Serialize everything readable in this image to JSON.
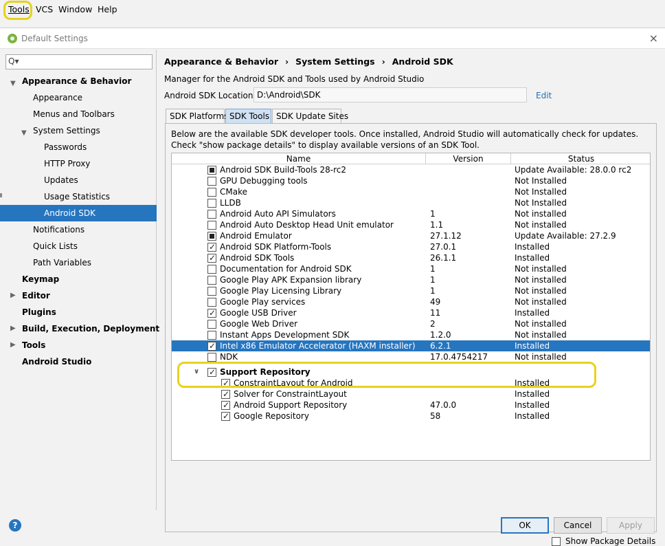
{
  "menubar": {
    "items": [
      "Tools",
      "VCS",
      "Window",
      "Help"
    ]
  },
  "dialog": {
    "title": "Default Settings",
    "close": "×"
  },
  "sidebar": {
    "search_placeholder": "Q▾",
    "items": [
      {
        "label": "Appearance & Behavior"
      },
      {
        "label": "Appearance"
      },
      {
        "label": "Menus and Toolbars"
      },
      {
        "label": "System Settings"
      },
      {
        "label": "Passwords"
      },
      {
        "label": "HTTP Proxy"
      },
      {
        "label": "Updates"
      },
      {
        "label": "Usage Statistics"
      },
      {
        "label": "Android SDK"
      },
      {
        "label": "Notifications"
      },
      {
        "label": "Quick Lists"
      },
      {
        "label": "Path Variables"
      },
      {
        "label": "Keymap"
      },
      {
        "label": "Editor"
      },
      {
        "label": "Plugins"
      },
      {
        "label": "Build, Execution, Deployment"
      },
      {
        "label": "Tools"
      },
      {
        "label": "Android Studio"
      }
    ]
  },
  "main": {
    "breadcrumb": [
      "Appearance & Behavior",
      "System Settings",
      "Android SDK"
    ],
    "breadcrumb_sep": "›",
    "description": "Manager for the Android SDK and Tools used by Android Studio",
    "sdk_location_label": "Android SDK Location:",
    "sdk_location_value": "D:\\Android\\SDK",
    "edit_label": "Edit",
    "tabs": [
      {
        "label": "SDK Platforms"
      },
      {
        "label": "SDK Tools"
      },
      {
        "label": "SDK Update Sites"
      }
    ],
    "info_line1": "Below are the available SDK developer tools. Once installed, Android Studio will automatically check for updates.",
    "info_line2": "Check \"show package details\" to display available versions of an SDK Tool.",
    "columns": [
      "Name",
      "Version",
      "Status"
    ],
    "rows": [
      {
        "name": "Android SDK Build-Tools 28-rc2",
        "version": "",
        "status": "Update Available: 28.0.0 rc2",
        "check": "partial"
      },
      {
        "name": "GPU Debugging tools",
        "version": "",
        "status": "Not Installed",
        "check": "none"
      },
      {
        "name": "CMake",
        "version": "",
        "status": "Not Installed",
        "check": "none"
      },
      {
        "name": "LLDB",
        "version": "",
        "status": "Not Installed",
        "check": "none"
      },
      {
        "name": "Android Auto API Simulators",
        "version": "1",
        "status": "Not installed",
        "check": "none"
      },
      {
        "name": "Android Auto Desktop Head Unit emulator",
        "version": "1.1",
        "status": "Not installed",
        "check": "none"
      },
      {
        "name": "Android Emulator",
        "version": "27.1.12",
        "status": "Update Available: 27.2.9",
        "check": "partial"
      },
      {
        "name": "Android SDK Platform-Tools",
        "version": "27.0.1",
        "status": "Installed",
        "check": "checked"
      },
      {
        "name": "Android SDK Tools",
        "version": "26.1.1",
        "status": "Installed",
        "check": "checked"
      },
      {
        "name": "Documentation for Android SDK",
        "version": "1",
        "status": "Not installed",
        "check": "none"
      },
      {
        "name": "Google Play APK Expansion library",
        "version": "1",
        "status": "Not installed",
        "check": "none"
      },
      {
        "name": "Google Play Licensing Library",
        "version": "1",
        "status": "Not installed",
        "check": "none"
      },
      {
        "name": "Google Play services",
        "version": "49",
        "status": "Not installed",
        "check": "none"
      },
      {
        "name": "Google USB Driver",
        "version": "11",
        "status": "Installed",
        "check": "checked"
      },
      {
        "name": "Google Web Driver",
        "version": "2",
        "status": "Not installed",
        "check": "none"
      },
      {
        "name": "Instant Apps Development SDK",
        "version": "1.2.0",
        "status": "Not installed",
        "check": "none"
      },
      {
        "name": "Intel x86 Emulator Accelerator (HAXM installer)",
        "version": "6.2.1",
        "status": "Installed",
        "check": "checked"
      },
      {
        "name": "NDK",
        "version": "17.0.4754217",
        "status": "Not installed",
        "check": "none"
      }
    ],
    "group": {
      "name": "Support Repository",
      "check": "checked"
    },
    "group_rows": [
      {
        "name": "ConstraintLayout for Android",
        "version": "",
        "status": "Installed",
        "check": "checked"
      },
      {
        "name": "Solver for ConstraintLayout",
        "version": "",
        "status": "Installed",
        "check": "checked"
      },
      {
        "name": "Android Support Repository",
        "version": "47.0.0",
        "status": "Installed",
        "check": "checked"
      },
      {
        "name": "Google Repository",
        "version": "58",
        "status": "Installed",
        "check": "checked"
      }
    ],
    "show_details_label": "Show Package Details"
  },
  "footer": {
    "help": "?",
    "ok": "OK",
    "cancel": "Cancel",
    "apply": "Apply"
  },
  "colors": {
    "selection": "#2675bf",
    "highlight": "#e6d21e",
    "link": "#2470b3"
  }
}
